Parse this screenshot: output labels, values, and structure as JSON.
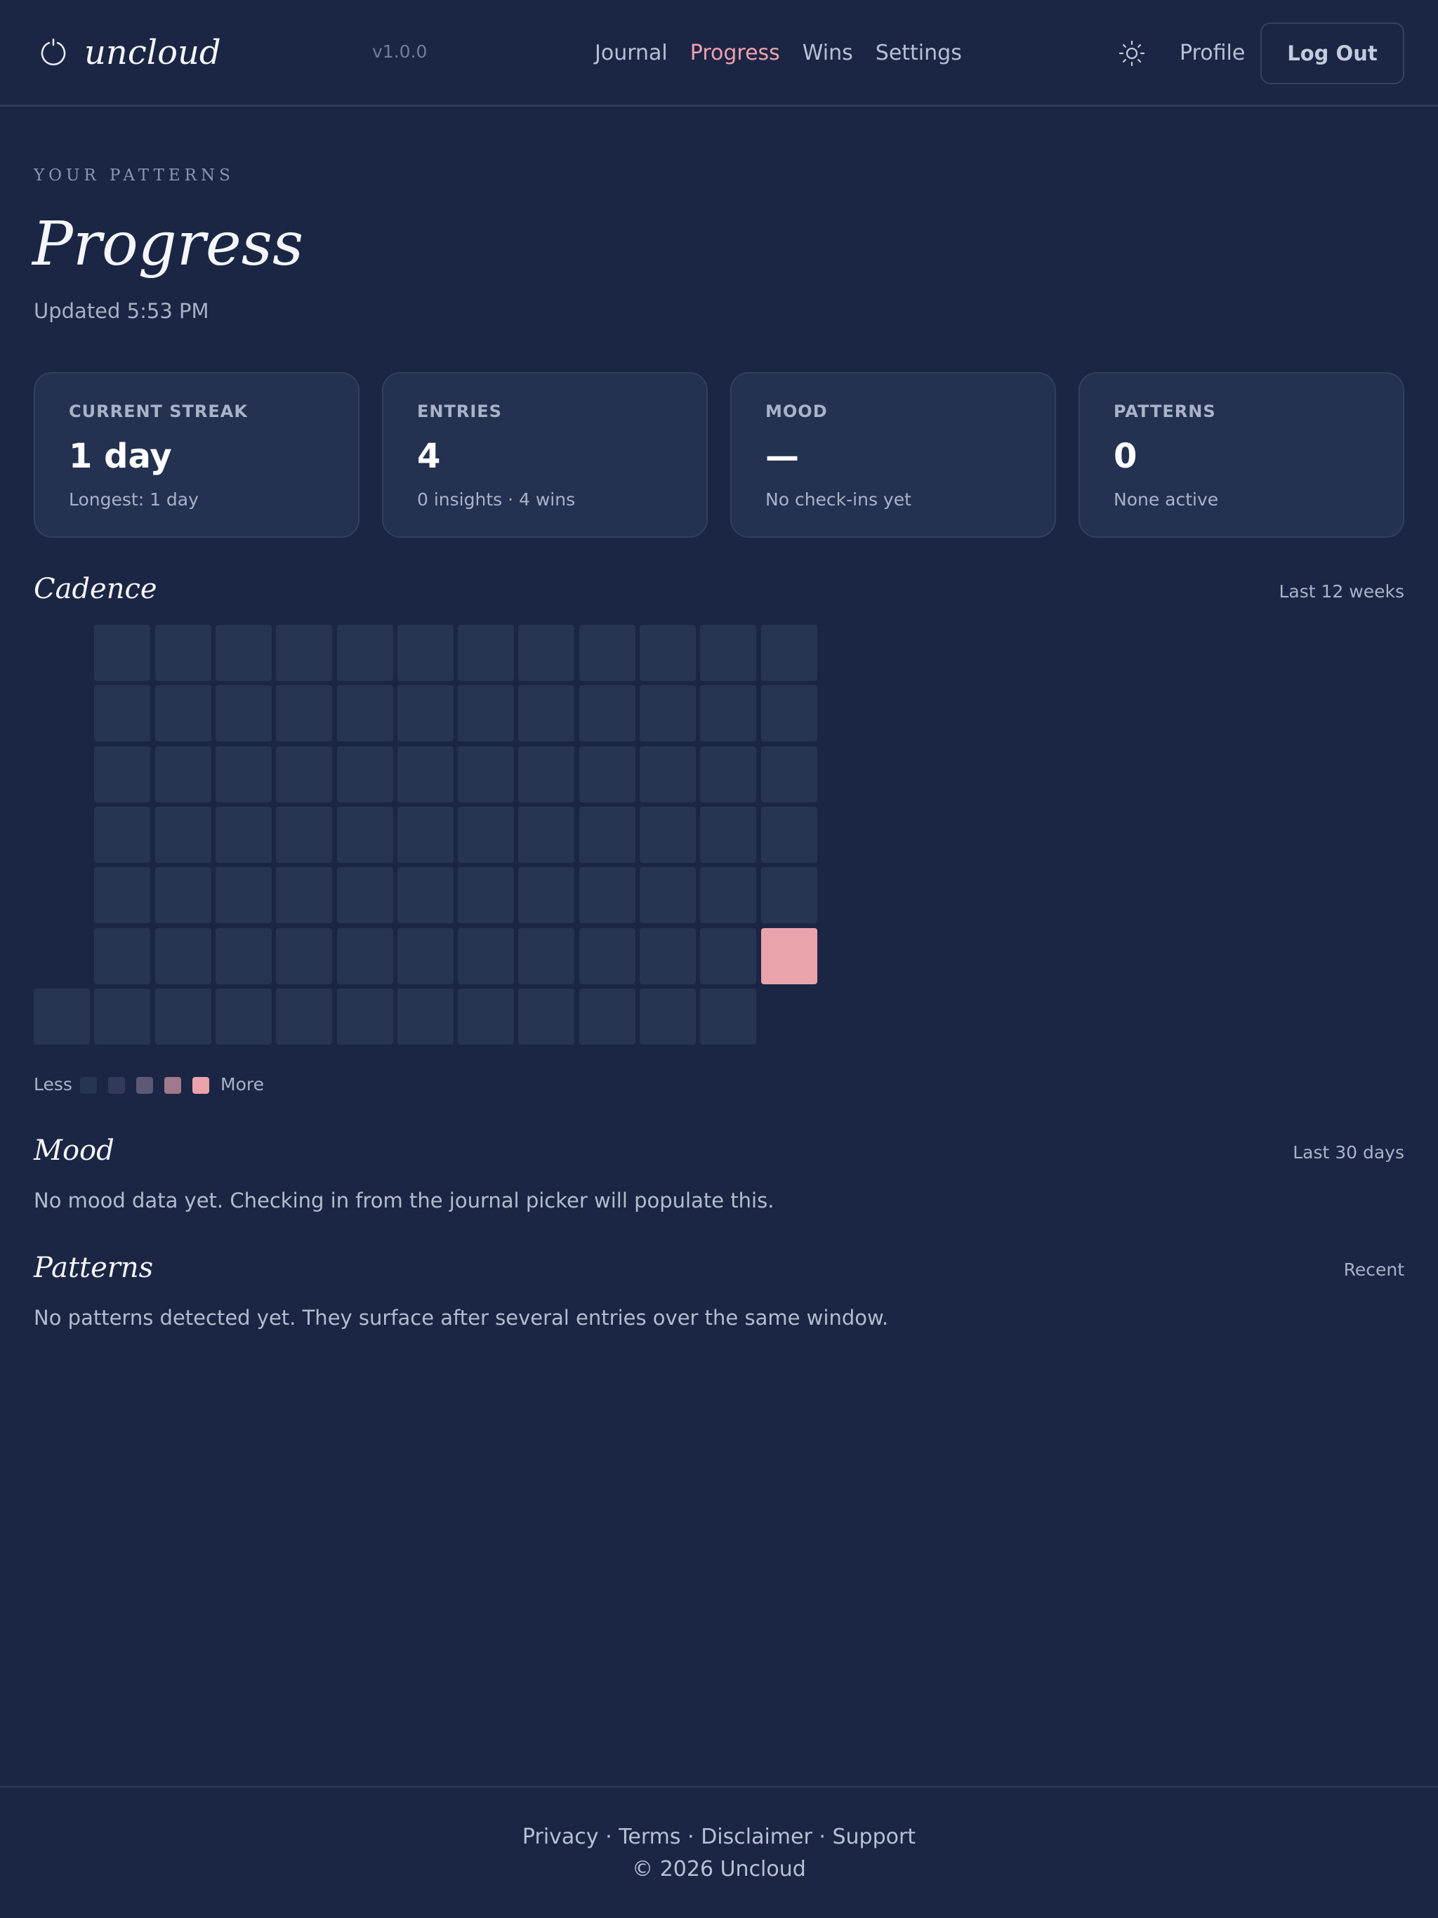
{
  "header": {
    "brand": "uncloud",
    "version": "v1.0.0",
    "nav": [
      {
        "label": "Journal",
        "active": false
      },
      {
        "label": "Progress",
        "active": true
      },
      {
        "label": "Wins",
        "active": false
      },
      {
        "label": "Settings",
        "active": false
      }
    ],
    "theme_icon": "sun-icon",
    "profile_label": "Profile",
    "logout_label": "Log Out"
  },
  "page": {
    "eyebrow": "YOUR PATTERNS",
    "title": "Progress",
    "updated": "Updated 5:53 PM"
  },
  "stats": [
    {
      "label": "CURRENT STREAK",
      "value": "1 day",
      "sub": "Longest: 1 day"
    },
    {
      "label": "ENTRIES",
      "value": "4",
      "sub": "0 insights · 4 wins"
    },
    {
      "label": "MOOD",
      "value": "—",
      "sub": "No check-ins yet"
    },
    {
      "label": "PATTERNS",
      "value": "0",
      "sub": "None active"
    }
  ],
  "cadence": {
    "title": "Cadence",
    "range": "Last 12 weeks",
    "weeks": 13,
    "days_per_week": 7,
    "first_week_start_row": 6,
    "last_week_days": 6,
    "active_cell": {
      "week": 12,
      "day": 5,
      "level": 4
    },
    "legend_less": "Less",
    "legend_more": "More",
    "legend_colors": [
      "#273552",
      "#33395a",
      "#5c5876",
      "#a07a8c",
      "#eba3ab"
    ]
  },
  "mood": {
    "title": "Mood",
    "range": "Last 30 days",
    "empty_text": "No mood data yet. Checking in from the journal picker will populate this."
  },
  "patterns": {
    "title": "Patterns",
    "range": "Recent",
    "empty_text": "No patterns detected yet. They surface after several entries over the same window."
  },
  "footer": {
    "links": [
      "Privacy",
      "Terms",
      "Disclaimer",
      "Support"
    ],
    "separator": "·",
    "copyright": "© 2026 Uncloud"
  },
  "colors": {
    "background": "#1b2644",
    "card": "#243150",
    "accent": "#f0a0ae"
  }
}
